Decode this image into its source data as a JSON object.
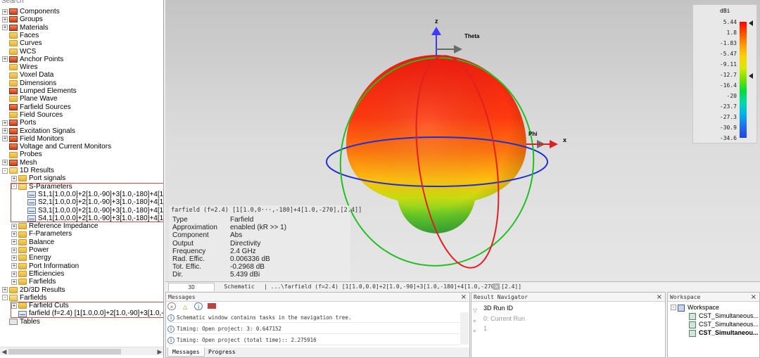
{
  "search": {
    "placeholder": "Search"
  },
  "tree": [
    {
      "label": "Components",
      "exp": "+",
      "indent": 0,
      "icon": "red"
    },
    {
      "label": "Groups",
      "exp": "+",
      "indent": 0,
      "icon": "red"
    },
    {
      "label": "Materials",
      "exp": "+",
      "indent": 0,
      "icon": "red"
    },
    {
      "label": "Faces",
      "exp": "",
      "indent": 0,
      "icon": "folder"
    },
    {
      "label": "Curves",
      "exp": "",
      "indent": 0,
      "icon": "folder"
    },
    {
      "label": "WCS",
      "exp": "",
      "indent": 0,
      "icon": "folder"
    },
    {
      "label": "Anchor Points",
      "exp": "+",
      "indent": 0,
      "icon": "red"
    },
    {
      "label": "Wires",
      "exp": "",
      "indent": 0,
      "icon": "folder"
    },
    {
      "label": "Voxel Data",
      "exp": "",
      "indent": 0,
      "icon": "folder"
    },
    {
      "label": "Dimensions",
      "exp": "",
      "indent": 0,
      "icon": "folder"
    },
    {
      "label": "Lumped Elements",
      "exp": "",
      "indent": 0,
      "icon": "red"
    },
    {
      "label": "Plane Wave",
      "exp": "",
      "indent": 0,
      "icon": "folder"
    },
    {
      "label": "Farfield Sources",
      "exp": "",
      "indent": 0,
      "icon": "red"
    },
    {
      "label": "Field Sources",
      "exp": "",
      "indent": 0,
      "icon": "folder"
    },
    {
      "label": "Ports",
      "exp": "+",
      "indent": 0,
      "icon": "red"
    },
    {
      "label": "Excitation Signals",
      "exp": "+",
      "indent": 0,
      "icon": "red"
    },
    {
      "label": "Field Monitors",
      "exp": "+",
      "indent": 0,
      "icon": "red"
    },
    {
      "label": "Voltage and Current Monitors",
      "exp": "",
      "indent": 0,
      "icon": "red"
    },
    {
      "label": "Probes",
      "exp": "",
      "indent": 0,
      "icon": "folder"
    },
    {
      "label": "Mesh",
      "exp": "+",
      "indent": 0,
      "icon": "red"
    },
    {
      "label": "1D Results",
      "exp": "-",
      "indent": 0,
      "icon": "open"
    },
    {
      "label": "Port signals",
      "exp": "+",
      "indent": 1,
      "icon": "folder"
    },
    {
      "label": "S-Parameters",
      "exp": "-",
      "indent": 1,
      "icon": "open"
    },
    {
      "label": "S1,1[1.0,0.0]+2[1.0,-90]+3[1.0,-180]+4[1.0",
      "exp": "",
      "indent": 2,
      "icon": "sparam"
    },
    {
      "label": "S2,1[1.0,0.0]+2[1.0,-90]+3[1.0,-180]+4[1.0",
      "exp": "",
      "indent": 2,
      "icon": "sparam"
    },
    {
      "label": "S3,1[1.0,0.0]+2[1.0,-90]+3[1.0,-180]+4[1.0",
      "exp": "",
      "indent": 2,
      "icon": "sparam"
    },
    {
      "label": "S4,1[1.0,0.0]+2[1.0,-90]+3[1.0,-180]+4[1.0",
      "exp": "",
      "indent": 2,
      "icon": "sparam"
    },
    {
      "label": "Reference Impedance",
      "exp": "+",
      "indent": 1,
      "icon": "folder"
    },
    {
      "label": "F-Parameters",
      "exp": "+",
      "indent": 1,
      "icon": "folder"
    },
    {
      "label": "Balance",
      "exp": "+",
      "indent": 1,
      "icon": "folder"
    },
    {
      "label": "Power",
      "exp": "+",
      "indent": 1,
      "icon": "folder"
    },
    {
      "label": "Energy",
      "exp": "+",
      "indent": 1,
      "icon": "folder"
    },
    {
      "label": "Port Information",
      "exp": "+",
      "indent": 1,
      "icon": "folder"
    },
    {
      "label": "Efficiencies",
      "exp": "+",
      "indent": 1,
      "icon": "folder"
    },
    {
      "label": "Farfields",
      "exp": "+",
      "indent": 1,
      "icon": "folder"
    },
    {
      "label": "2D/3D Results",
      "exp": "+",
      "indent": 0,
      "icon": "folder"
    },
    {
      "label": "Farfields",
      "exp": "-",
      "indent": 0,
      "icon": "open"
    },
    {
      "label": "Farfield Cuts",
      "exp": "+",
      "indent": 1,
      "icon": "folder"
    },
    {
      "label": "farfield (f=2.4) [1[1.0,0.0]+2[1.0,-90]+3[1.0,-18",
      "exp": "",
      "indent": 1,
      "icon": "sparam"
    },
    {
      "label": "Tables",
      "exp": "",
      "indent": 0,
      "icon": "tables"
    }
  ],
  "view": {
    "axis_z": "z",
    "axis_theta": "Theta",
    "axis_phi": "Phi",
    "axis_x": "x"
  },
  "legend": {
    "unit": "dBi",
    "ticks": [
      "5.44",
      "1.8",
      "-1.83",
      "-5.47",
      "-9.11",
      "-12.7",
      "-16.4",
      "-20",
      "-23.7",
      "-27.3",
      "-30.9",
      "-34.6"
    ]
  },
  "info": {
    "title": "farfield (f=2.4) [1[1.0,0···,-180]+4[1.0,-270],[2.4]]",
    "rows": [
      {
        "k": "Type",
        "v": "Farfield"
      },
      {
        "k": "Approximation",
        "v": "enabled (kR >> 1)"
      },
      {
        "k": "Component",
        "v": "Abs"
      },
      {
        "k": "Output",
        "v": "Directivity"
      },
      {
        "k": "Frequency",
        "v": "2.4 GHz"
      },
      {
        "k": "Rad. Effic.",
        "v": "0.006336 dB"
      },
      {
        "k": "Tot. Effic.",
        "v": "-0.2968 dB"
      },
      {
        "k": "Dir.",
        "v": "5.439 dBi"
      }
    ]
  },
  "view_tabs": {
    "tab_3d": "3D",
    "tab_schematic": "Schematic",
    "tab_farfield": "|  ...\\farfield (f=2.4) [1[1.0,0.0]+2[1.0,-90]+3[1.0,-180]+4[1.0,-270],[2.4]]"
  },
  "messages": {
    "title": "Messages",
    "rows": [
      "Schematic window contains tasks in the navigation tree.",
      "Timing: Open project: 3: 0.647152",
      "Timing: Open project (total time):: 2.275916"
    ],
    "tab_messages": "Messages",
    "tab_progress": "Progress"
  },
  "result_nav": {
    "title": "Result Navigator",
    "header": "3D Run ID",
    "rows": [
      "0: Current Run",
      "1"
    ]
  },
  "workspace": {
    "title": "Workspace",
    "root": "Workspace",
    "items": [
      "CST_Simultaneous...",
      "CST_Simultaneous...",
      "CST_Simultaneou..."
    ]
  },
  "colors": {
    "selection_box": "#d24a4a",
    "axis_arrow": "#3a3aff",
    "theta_arrow": "#6a6a6a",
    "red_ring": "#e02020",
    "green_ring": "#20c020",
    "blue_ring": "#2030d0"
  }
}
